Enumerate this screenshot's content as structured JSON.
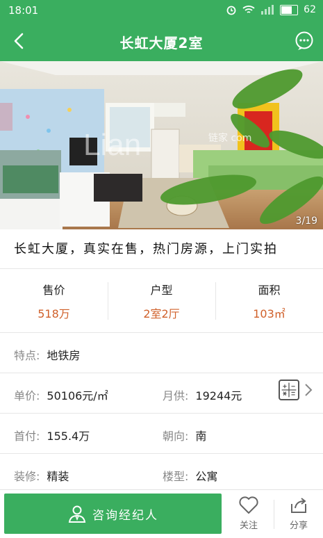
{
  "status_bar": {
    "time": "18:01",
    "battery": "62",
    "battery_level": 0.62
  },
  "header": {
    "title": "长虹大厦2室"
  },
  "gallery": {
    "counter": "3/19",
    "watermark": "链家 com"
  },
  "headline": "长虹大厦，真实在售，热门房源，上门实拍",
  "stats": [
    {
      "label": "售价",
      "value": "518万"
    },
    {
      "label": "户型",
      "value": "2室2厅"
    },
    {
      "label": "面积",
      "value": "103㎡"
    }
  ],
  "details": {
    "feature": {
      "label": "特点:",
      "value": "地铁房"
    },
    "unit_price": {
      "label": "单价:",
      "value": "50106元/㎡"
    },
    "monthly": {
      "label": "月供:",
      "value": "19244元"
    },
    "down_payment": {
      "label": "首付:",
      "value": "155.4万"
    },
    "orientation": {
      "label": "朝向:",
      "value": "南"
    },
    "decoration": {
      "label": "装修:",
      "value": "精装"
    },
    "building_type": {
      "label": "楼型:",
      "value": "公寓"
    }
  },
  "bottom_bar": {
    "consult_label": "咨询经纪人",
    "follow_label": "关注",
    "share_label": "分享"
  },
  "colors": {
    "brand_green": "#3aae5f",
    "price_orange": "#d0602a"
  }
}
